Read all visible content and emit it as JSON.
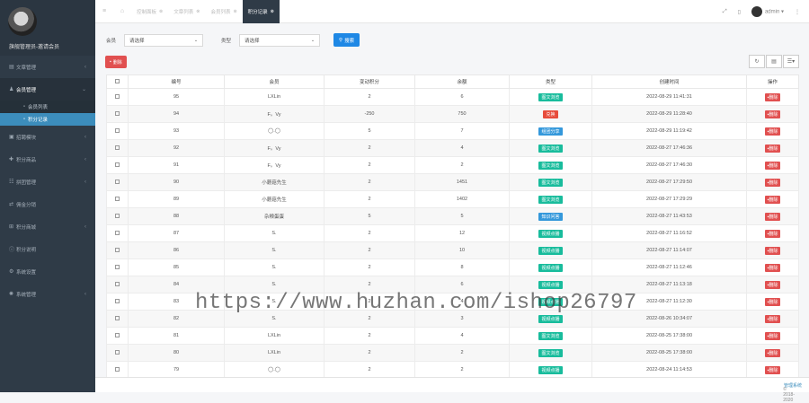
{
  "sidebar": {
    "profile_name": "旗舰管理员-邀请会员",
    "items": [
      {
        "label": "文章管理",
        "icon": "document-icon",
        "arrow": "‹"
      },
      {
        "label": "会员管理",
        "icon": "user-group-icon",
        "arrow": "⌄",
        "open": true
      },
      {
        "label": "招聘模块",
        "icon": "briefcase-icon",
        "arrow": "‹"
      },
      {
        "label": "积分商品",
        "icon": "gift-icon",
        "arrow": "‹"
      },
      {
        "label": "拼团管理",
        "icon": "team-icon",
        "arrow": "‹"
      },
      {
        "label": "佣金分销",
        "icon": "share-icon",
        "arrow": ""
      },
      {
        "label": "积分商城",
        "icon": "cart-icon",
        "arrow": "‹"
      },
      {
        "label": "积分说明",
        "icon": "info-icon",
        "arrow": ""
      },
      {
        "label": "系统设置",
        "icon": "gear-icon",
        "arrow": ""
      },
      {
        "label": "系统管理",
        "icon": "cog-icon",
        "arrow": "‹"
      }
    ],
    "subitems": [
      "会员列表",
      "积分记录"
    ]
  },
  "topbar": {
    "tabs": [
      {
        "label": "控制面板"
      },
      {
        "label": "文章列表"
      },
      {
        "label": "会员列表"
      },
      {
        "label": "积分记录"
      }
    ],
    "user": "admin"
  },
  "search": {
    "member_label": "会员",
    "member_value": "请选择",
    "type_label": "类型",
    "type_value": "请选择",
    "button": "搜索"
  },
  "toolbar": {
    "delete": "删除"
  },
  "table": {
    "headers": [
      "编号",
      "会员",
      "变动积分",
      "余额",
      "类型",
      "创建时间",
      "操作"
    ],
    "row_button": "删除",
    "rows": [
      [
        "95",
        "LXLin",
        "2",
        "6",
        "图文浏览",
        "2022-08-29 11:41:31",
        "green"
      ],
      [
        "94",
        "F。Vy",
        "-250",
        "750",
        "兑换",
        "2022-08-29 11:28:40",
        "red"
      ],
      [
        "93",
        "◯.◯",
        "5",
        "7",
        "组团分享",
        "2022-08-29 11:19:42",
        "blue"
      ],
      [
        "92",
        "F。Vy",
        "2",
        "4",
        "图文浏览",
        "2022-08-27 17:46:36",
        "green"
      ],
      [
        "91",
        "F。Vy",
        "2",
        "2",
        "图文浏览",
        "2022-08-27 17:46:30",
        "green"
      ],
      [
        "90",
        "小蘑菇先生",
        "2",
        "1451",
        "图文浏览",
        "2022-08-27 17:29:50",
        "green"
      ],
      [
        "89",
        "小蘑菇先生",
        "2",
        "1402",
        "图文浏览",
        "2022-08-27 17:29:29",
        "green"
      ],
      [
        "88",
        "杂粮蛋蛋",
        "5",
        "5",
        "知识问答",
        "2022-08-27 11:43:53",
        "blue"
      ],
      [
        "87",
        "S.",
        "2",
        "12",
        "视频点播",
        "2022-08-27 11:16:52",
        "green"
      ],
      [
        "86",
        "S.",
        "2",
        "10",
        "视频点播",
        "2022-08-27 11:14:07",
        "green"
      ],
      [
        "85",
        "S.",
        "2",
        "8",
        "视频点播",
        "2022-08-27 11:12:46",
        "green"
      ],
      [
        "84",
        "S.",
        "2",
        "6",
        "视频点播",
        "2022-08-27 11:13:18",
        "green"
      ],
      [
        "83",
        "S.",
        "2",
        "4",
        "视频点播",
        "2022-08-27 11:12:30",
        "green"
      ],
      [
        "82",
        "S.",
        "2",
        "3",
        "视频点播",
        "2022-08-26 10:34:07",
        "green"
      ],
      [
        "81",
        "LXLin",
        "2",
        "4",
        "图文浏览",
        "2022-08-25 17:38:00",
        "green"
      ],
      [
        "80",
        "LXLin",
        "2",
        "2",
        "图文浏览",
        "2022-08-25 17:38:00",
        "green"
      ],
      [
        "79",
        "◯.◯",
        "2",
        "2",
        "视频点播",
        "2022-08-24 11:14:53",
        "green"
      ]
    ]
  },
  "watermark": "https://www.huzhan.com/ishop26797",
  "footer": {
    "copyright": "© 2018-2020",
    "link": "管理系统"
  }
}
